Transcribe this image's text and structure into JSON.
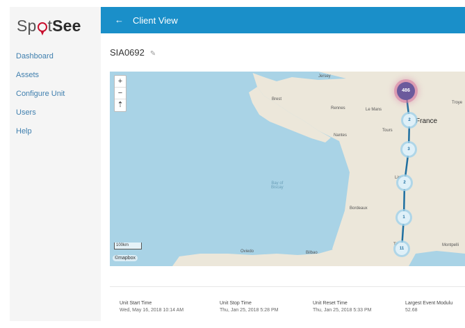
{
  "brand": {
    "part1": "Sp",
    "part2": "t",
    "part3": "See"
  },
  "sidebar": {
    "items": [
      {
        "label": "Dashboard"
      },
      {
        "label": "Assets"
      },
      {
        "label": "Configure Unit"
      },
      {
        "label": "Users"
      },
      {
        "label": "Help"
      }
    ]
  },
  "header": {
    "back_icon": "arrow-left-icon",
    "back_glyph": "←",
    "title": "Client View"
  },
  "unit": {
    "id": "SIA0692",
    "edit_icon": "pencil-icon",
    "edit_glyph": "✎"
  },
  "map": {
    "zoom_in": "+",
    "zoom_out": "−",
    "reset": "⇡",
    "scale_label": "100km",
    "attribution": "©mapbox",
    "labels": {
      "jersey": "Jersey",
      "brest": "Brest",
      "rennes": "Rennes",
      "lemans": "Le Mans",
      "nantes": "Nantes",
      "tours": "Tours",
      "france": "France",
      "troyes": "Troye",
      "limoges": "Limo",
      "bordeaux": "Bordeaux",
      "toulouse": "Toulo",
      "montpellier": "Montpelli",
      "bilbao": "Bilbao",
      "oviedo": "Oviedo",
      "sea_line1": "Bay of",
      "sea_line2": "Biscay"
    },
    "markers": [
      {
        "label": "486",
        "highlight": true
      },
      {
        "label": "2",
        "highlight": false
      },
      {
        "label": "3",
        "highlight": false
      },
      {
        "label": "2",
        "highlight": false
      },
      {
        "label": "1",
        "highlight": false
      },
      {
        "label": "11",
        "highlight": false
      }
    ],
    "route_color": "#1f6fa0",
    "water_color": "#a9d3e6",
    "land_color": "#ece7da"
  },
  "stats": [
    {
      "label": "Unit Start Time",
      "value": "Wed, May 16, 2018 10:14 AM"
    },
    {
      "label": "Unit Stop Time",
      "value": "Thu, Jan 25, 2018 5:28 PM"
    },
    {
      "label": "Unit Reset Time",
      "value": "Thu, Jan 25, 2018 5:33 PM"
    },
    {
      "label": "Largest Event Modulu",
      "value": "52.68"
    }
  ]
}
